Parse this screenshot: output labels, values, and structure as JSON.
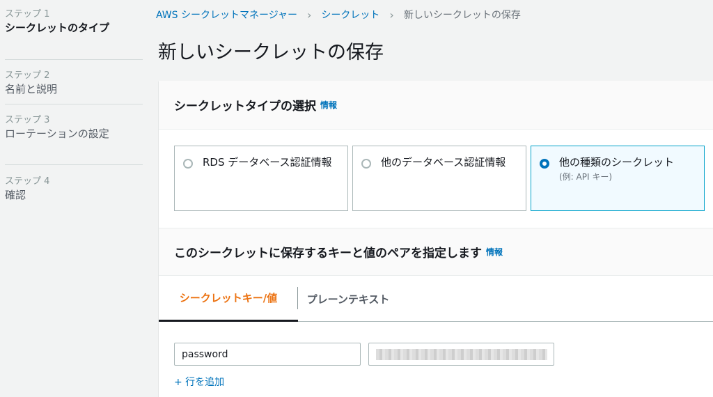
{
  "sidebar": {
    "steps": [
      {
        "number": "ステップ 1",
        "title": "シークレットのタイプ"
      },
      {
        "number": "ステップ 2",
        "title": "名前と説明"
      },
      {
        "number": "ステップ 3",
        "title": "ローテーションの設定"
      },
      {
        "number": "ステップ 4",
        "title": "確認"
      }
    ]
  },
  "breadcrumb": {
    "items": [
      "AWS シークレットマネージャー",
      "シークレット",
      "新しいシークレットの保存"
    ],
    "separator": "›"
  },
  "page": {
    "title": "新しいシークレットの保存"
  },
  "secret_type": {
    "heading": "シークレットタイプの選択",
    "info_label": "情報",
    "options": [
      {
        "label": "RDS データベース認証情報",
        "sub": "",
        "selected": false
      },
      {
        "label": "他のデータベース認証情報",
        "sub": "",
        "selected": false
      },
      {
        "label": "他の種類のシークレット",
        "sub": "(例: API キー)",
        "selected": true
      }
    ]
  },
  "key_value": {
    "heading": "このシークレットに保存するキーと値のペアを指定します",
    "info_label": "情報",
    "tabs": [
      "シークレットキー/値",
      "プレーンテキスト"
    ],
    "key_value_input": "password",
    "add_row_label": "+ 行を追加"
  },
  "colors": {
    "accent": "#ec7211",
    "link": "#0073bb",
    "selected_border": "#00a1c9"
  }
}
